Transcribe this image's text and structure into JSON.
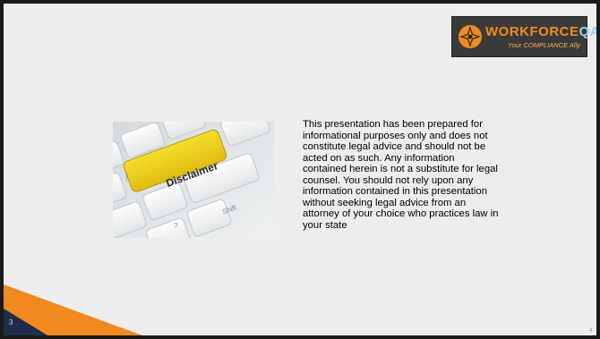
{
  "slide": {
    "logo": {
      "brand_main": "WORKFORCE",
      "brand_accent": "QA",
      "tagline": "Your COMPLIANCE Ally",
      "mark_icon": "compass-star-icon"
    },
    "image": {
      "key_label": "Disclaimer",
      "shift_label": "Shift",
      "question_key": "?",
      "bracket_key": "]"
    },
    "body_text": "This presentation has been prepared for\ninformational purposes only and does not\nconstitute legal advice and should not be\nacted on as such.  Any information\ncontained herein is not a substitute for legal\ncounsel.  You should not rely upon any\ninformation contained in this presentation\nwithout seeking legal advice from an\nattorney of your choice who practices law in\nyour state",
    "page_number": "3",
    "corner_mark": "4"
  },
  "colors": {
    "background": "#ededed",
    "frame": "#1a1a1a",
    "orange": "#f0891f",
    "navy": "#1f2d4a",
    "disclaimer_key": "#f2d21a"
  }
}
